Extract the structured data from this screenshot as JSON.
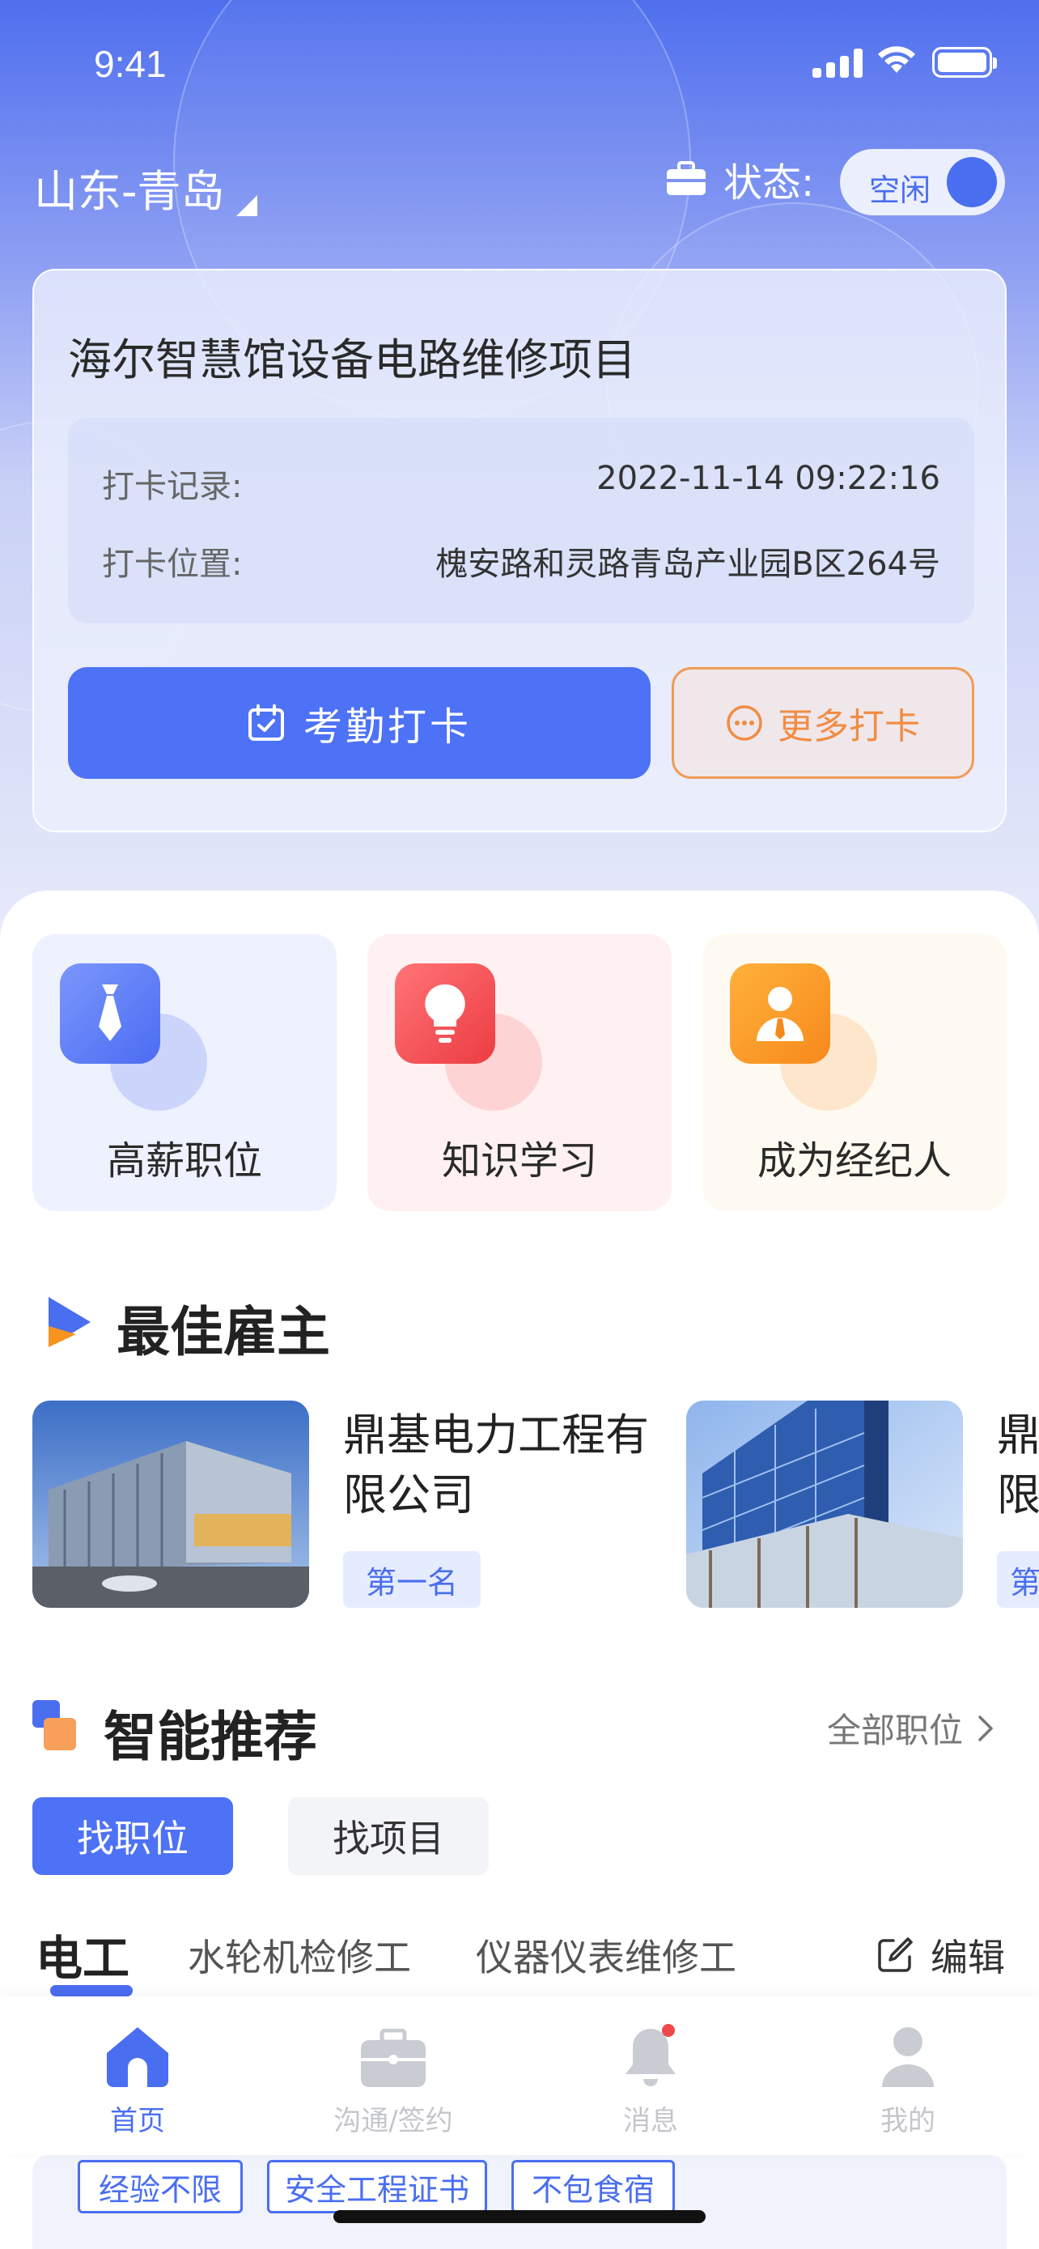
{
  "status_bar": {
    "time": "9:41"
  },
  "header": {
    "location": "山东-青岛",
    "status_label": "状态:",
    "status_value": "空闲"
  },
  "attendance_card": {
    "title": "海尔智慧馆设备电路维修项目",
    "record_label": "打卡记录:",
    "record_value": "2022-11-14 09:22:16",
    "location_label": "打卡位置:",
    "location_value": "槐安路和灵路青岛产业园B区264号",
    "primary_button": "考勤打卡",
    "secondary_button": "更多打卡"
  },
  "quick_entries": [
    {
      "label": "高薪职位",
      "icon": "tie-icon",
      "color": "#5b7cf6"
    },
    {
      "label": "知识学习",
      "icon": "lightbulb-icon",
      "color": "#f24d4f"
    },
    {
      "label": "成为经纪人",
      "icon": "agent-icon",
      "color": "#f7931e"
    }
  ],
  "best_employers": {
    "title": "最佳雇主",
    "items": [
      {
        "name": "鼎基电力工程有限公司",
        "name_line1": "鼎基电力工程有",
        "name_line2": "限公司",
        "rank": "第一名"
      },
      {
        "name_partial_line1": "鼎",
        "name_partial_line2": "限",
        "rank_partial": "第"
      }
    ]
  },
  "recommend": {
    "title": "智能推荐",
    "all_link": "全部职位",
    "segments": [
      "找职位",
      "找项目"
    ],
    "job_tabs": [
      "电工",
      "水轮机检修工",
      "仪器仪表维修工"
    ],
    "edit_label": "编辑",
    "filter_chips": [
      "经验不限",
      "安全工程证书",
      "不包食宿"
    ]
  },
  "tabbar": {
    "items": [
      {
        "label": "首页",
        "icon": "home-icon"
      },
      {
        "label": "沟通/签约",
        "icon": "briefcase-icon"
      },
      {
        "label": "消息",
        "icon": "bell-icon"
      },
      {
        "label": "我的",
        "icon": "user-icon"
      }
    ]
  },
  "colors": {
    "primary": "#4d72f5",
    "accent_orange": "#f08d43",
    "badge_red": "#f0484a"
  }
}
